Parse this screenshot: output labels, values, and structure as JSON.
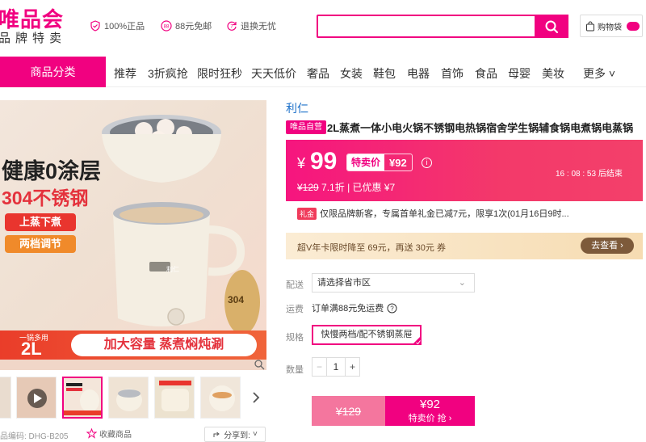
{
  "header": {
    "logo_main": "唯品会",
    "logo_sub": "品牌特卖",
    "promises": [
      "100%正品",
      "88元免邮",
      "退换无忧"
    ],
    "search_placeholder": "",
    "cart_label": "购物袋",
    "colors": {
      "brand": "#f10180"
    }
  },
  "nav": {
    "category_label": "商品分类",
    "items": [
      "推荐",
      "3折疯抢",
      "限时狂秒",
      "天天低价",
      "奢品",
      "女装",
      "鞋包",
      "电器",
      "首饰",
      "食品",
      "母婴",
      "美妆",
      "更多"
    ]
  },
  "gallery": {
    "overlay_texts": [
      "健康0涂层",
      "304不锈钢",
      "上蒸下煮",
      "两档调节",
      "一锅多用",
      "2L",
      "加大容量 蒸煮焖炖涮",
      "利仁",
      "304"
    ],
    "thumb_count": 6
  },
  "product": {
    "brand": "利仁",
    "badge": "唯品自营",
    "title": "2L蒸煮一体小电火锅不锈钢电热锅宿舍学生锅辅食锅电煮锅电蒸锅",
    "price_symbol": "¥",
    "price": "99",
    "special_label": "特卖价",
    "special_price": "¥92",
    "countdown": "16 : 08 : 53  后结束",
    "original_price": "¥129",
    "discount": "7.1折",
    "saved": "| 已优惠 ¥7",
    "coupon_tag": "礼金",
    "coupon_text": "仅限品牌新客，专属首单礼金已减7元，限享1次(01月16日9时...",
    "svip_text": "超V年卡限时降至 69元，再送 30元 券",
    "svip_button": "去查看 ›"
  },
  "options": {
    "delivery_label": "配送",
    "delivery_value": "请选择省市区",
    "freight_label": "运费",
    "freight_value": "订单满88元免运费",
    "spec_label": "规格",
    "spec_value": "快慢两档/配不锈钢蒸屉",
    "qty_label": "数量",
    "qty_value": "1"
  },
  "buy": {
    "orig_price": "¥129",
    "price": "¥92",
    "action": "特卖价 抢 ›"
  },
  "footer": {
    "sku": "品编码: DHG-B205",
    "favorite": "收藏商品",
    "share": "分享到:"
  }
}
